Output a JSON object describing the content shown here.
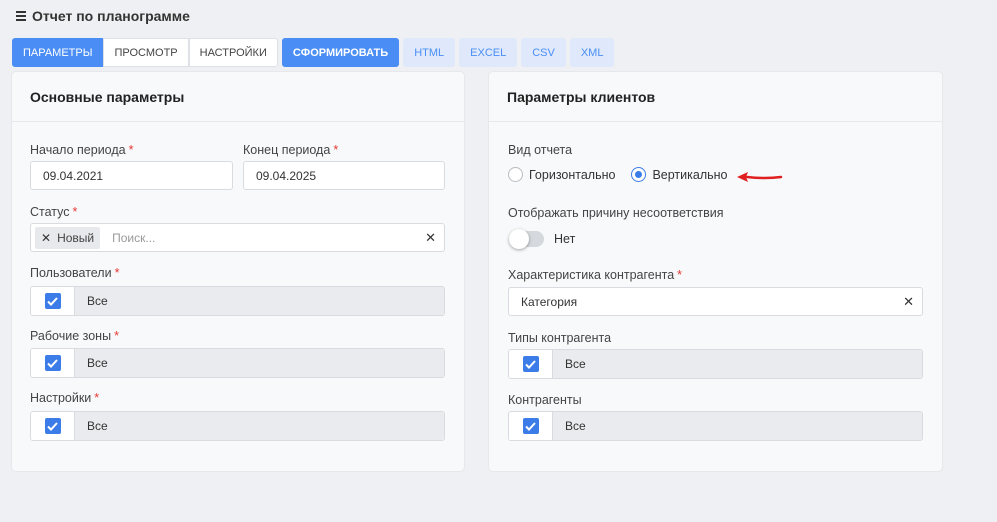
{
  "header": {
    "title": "Отчет по планограмме",
    "icon": "menu-icon"
  },
  "toolbar": {
    "tabs": [
      "ПАРАМЕТРЫ",
      "ПРОСМОТР",
      "НАСТРОЙКИ"
    ],
    "generate_label": "СФОРМИРОВАТЬ",
    "exports": [
      "HTML",
      "EXCEL",
      "CSV",
      "XML"
    ]
  },
  "main_params": {
    "title": "Основные параметры",
    "period_start": {
      "label": "Начало периода",
      "value": "09.04.2021"
    },
    "period_end": {
      "label": "Конец периода",
      "value": "09.04.2025"
    },
    "status": {
      "label": "Статус",
      "tag": "Новый",
      "placeholder": "Поиск..."
    },
    "users": {
      "label": "Пользователи",
      "value": "Все"
    },
    "work_zones": {
      "label": "Рабочие зоны",
      "value": "Все"
    },
    "settings": {
      "label": "Настройки",
      "value": "Все"
    },
    "required_mark": "*"
  },
  "client_params": {
    "title": "Параметры клиентов",
    "report_view": {
      "label": "Вид отчета",
      "options": [
        "Горизонтально",
        "Вертикально"
      ],
      "selected": "Вертикально"
    },
    "show_reason": {
      "label": "Отображать причину несоответствия",
      "value": "Нет"
    },
    "counterparty_char": {
      "label": "Характеристика контрагента",
      "value": "Категория"
    },
    "counterparty_types": {
      "label": "Типы контрагента",
      "value": "Все"
    },
    "counterparties": {
      "label": "Контрагенты",
      "value": "Все"
    }
  },
  "colors": {
    "accent": "#4a8ef5",
    "required": "#e53935",
    "arrow": "#e02020"
  }
}
